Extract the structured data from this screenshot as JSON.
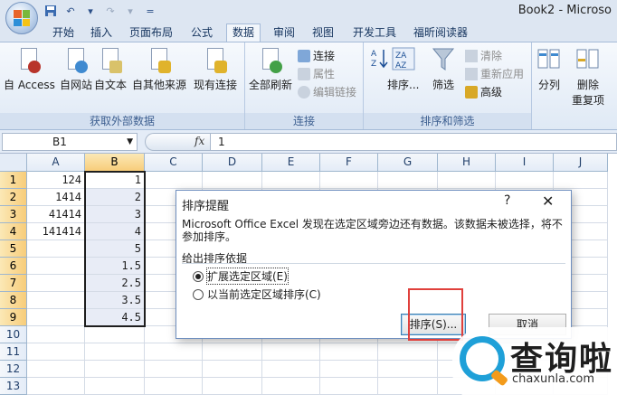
{
  "window": {
    "title": "Book2 - Microso"
  },
  "quick_access": {
    "save_icon": "save-icon",
    "undo_icon": "undo-icon",
    "redo_icon": "redo-icon",
    "undo_glyph": "↶",
    "redo_glyph": "↷",
    "dropdown_glyph": "▾",
    "customize_glyph": "="
  },
  "tabs": [
    "开始",
    "插入",
    "页面布局",
    "公式",
    "数据",
    "审阅",
    "视图",
    "开发工具",
    "福昕阅读器"
  ],
  "active_tab": "数据",
  "ribbon": {
    "get_external": {
      "label": "获取外部数据",
      "buttons": [
        "自 Access",
        "自网站",
        "自文本",
        "自其他来源",
        "现有连接"
      ]
    },
    "connections": {
      "label": "连接",
      "refresh_all": "全部刷新",
      "items": [
        "连接",
        "属性",
        "编辑链接"
      ]
    },
    "sort_filter": {
      "label": "排序和筛选",
      "sort": "排序...",
      "filter": "筛选",
      "items": [
        "清除",
        "重新应用",
        "高级"
      ]
    },
    "data_tools": {
      "split": "分列",
      "remove_dup_1": "删除",
      "remove_dup_2": "重复项"
    }
  },
  "formula_bar": {
    "name_box": "B1",
    "fx": "fx",
    "value": "1"
  },
  "columns": [
    "A",
    "B",
    "C",
    "D",
    "E",
    "F",
    "G",
    "H",
    "I",
    "J"
  ],
  "rows": [
    "1",
    "2",
    "3",
    "4",
    "5",
    "6",
    "7",
    "8",
    "9",
    "10",
    "11",
    "12",
    "13"
  ],
  "cells": {
    "A": [
      "124",
      "1414",
      "41414",
      "141414"
    ],
    "B": [
      "1",
      "2",
      "3",
      "4",
      "5",
      "1.5",
      "2.5",
      "3.5",
      "4.5"
    ]
  },
  "dialog": {
    "title": "排序提醒",
    "help": "?",
    "close": "✕",
    "message": "Microsoft Office Excel 发现在选定区域旁边还有数据。该数据未被选择，将不参加排序。",
    "section": "给出排序依据",
    "option_expand": "扩展选定区域(E)",
    "option_current": "以当前选定区域排序(C)",
    "sort_button": "排序(S)...",
    "cancel_button": "取消"
  },
  "watermark": {
    "text": "查询啦",
    "sub": "chaxunla.com"
  }
}
